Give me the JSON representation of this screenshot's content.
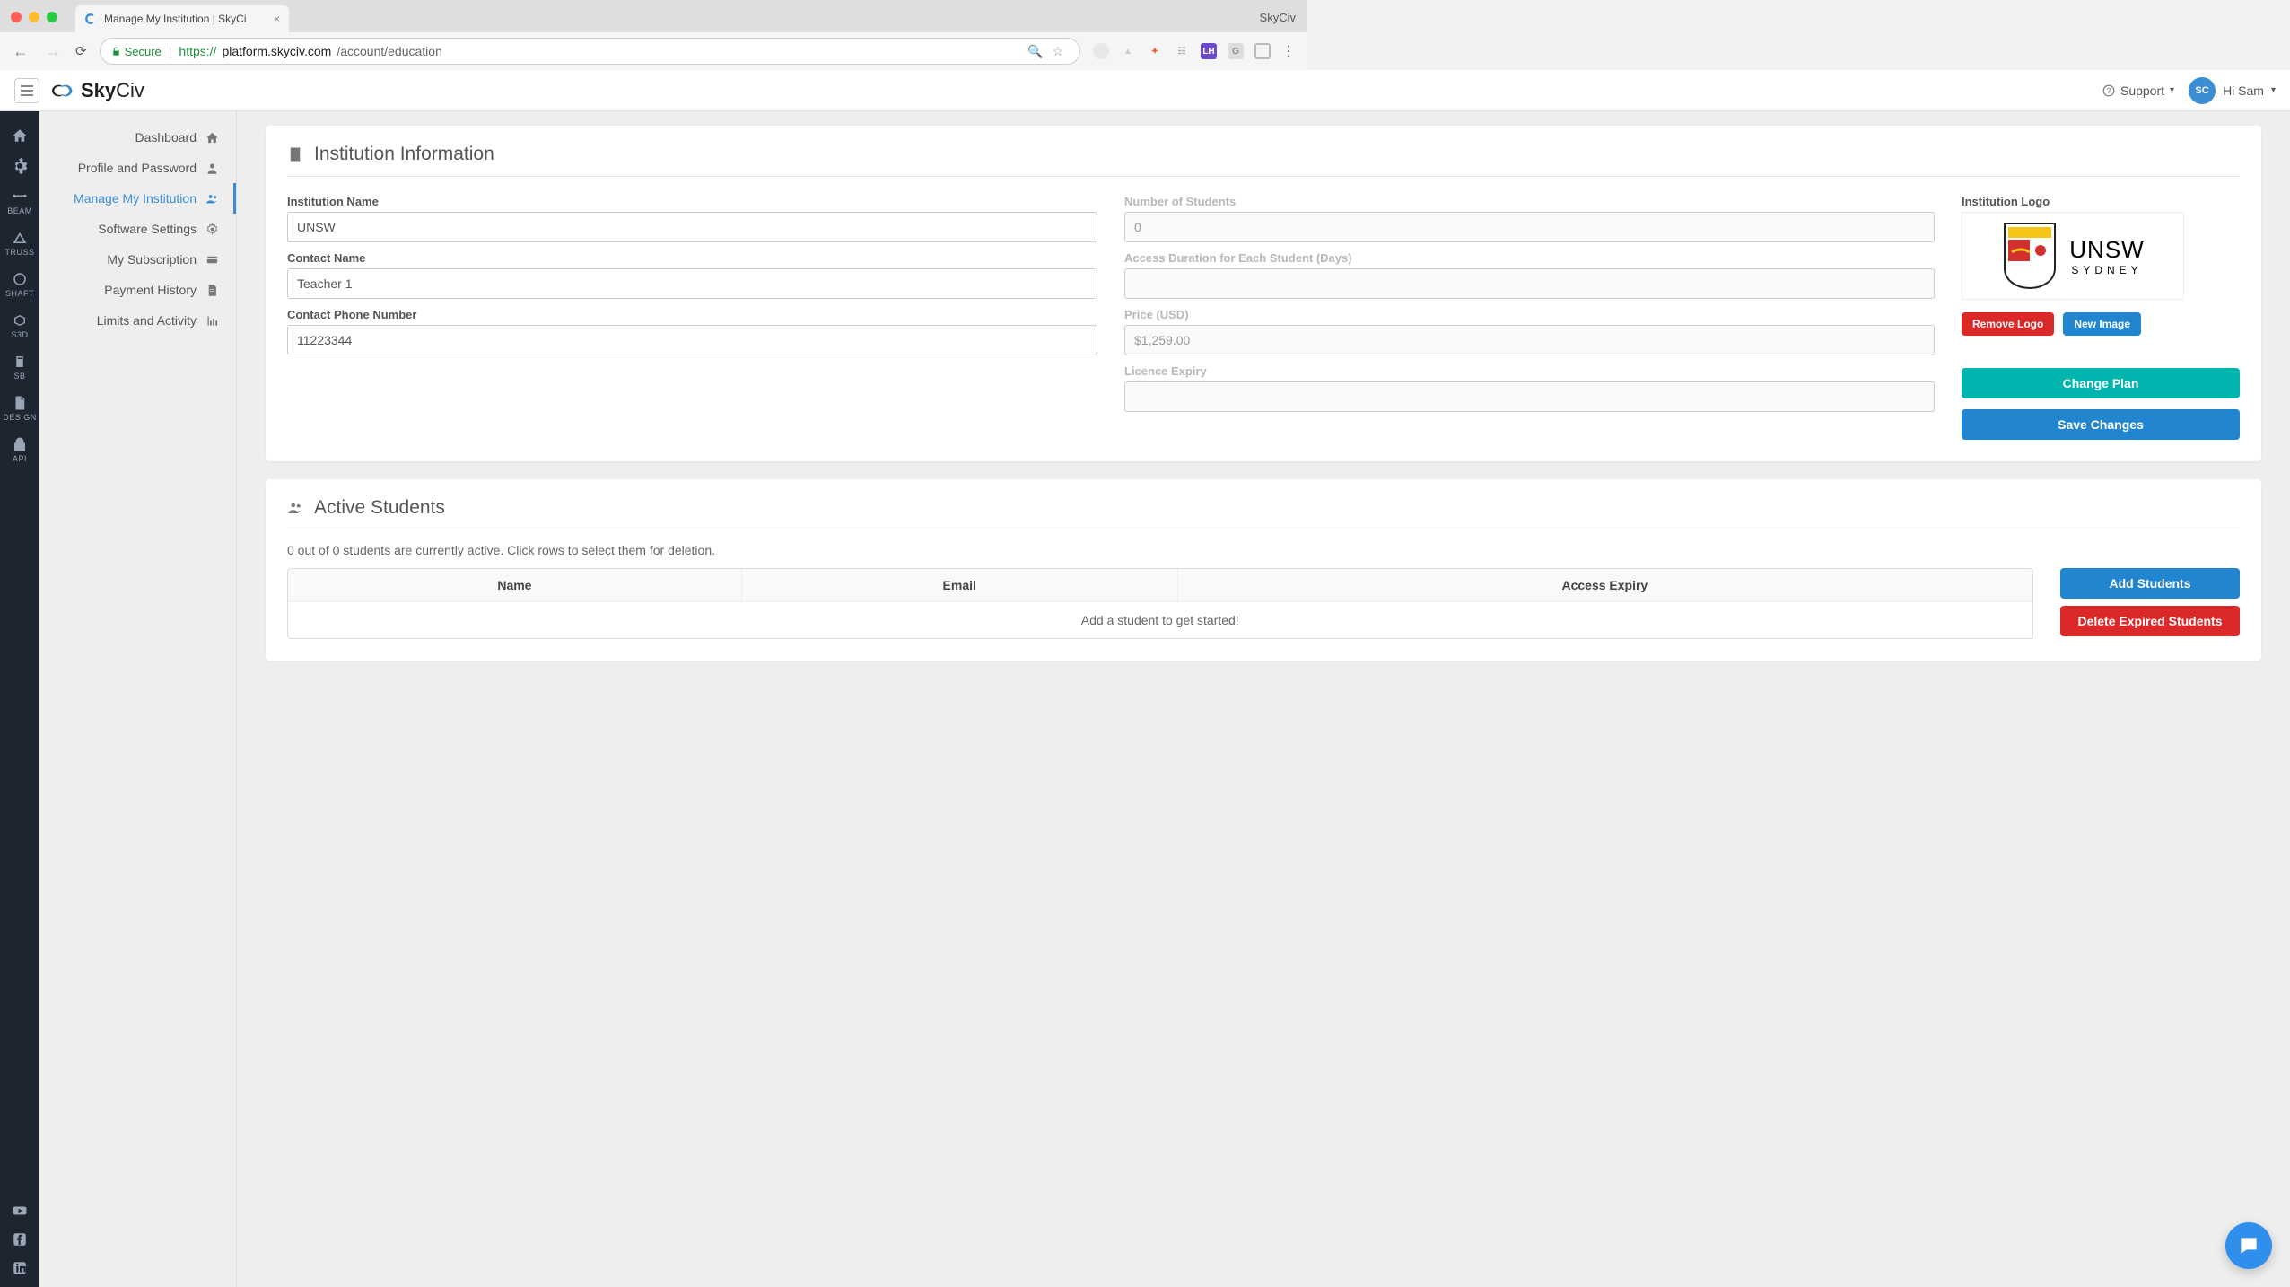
{
  "browser": {
    "tab_title": "Manage My Institution | SkyCi",
    "window_title": "SkyCiv",
    "secure_label": "Secure",
    "url_prefix": "https://",
    "url_host": "platform.skyciv.com",
    "url_path": "/account/education"
  },
  "topbar": {
    "brand_a": "Sky",
    "brand_b": "Civ",
    "support_label": "Support",
    "avatar": "SC",
    "greeting": "Hi Sam"
  },
  "sidebar_dark": {
    "items": [
      {
        "label": ""
      },
      {
        "label": ""
      },
      {
        "label": "BEAM"
      },
      {
        "label": "TRUSS"
      },
      {
        "label": "SHAFT"
      },
      {
        "label": "S3D"
      },
      {
        "label": "SB"
      },
      {
        "label": "DESIGN"
      },
      {
        "label": "API"
      }
    ]
  },
  "settings_nav": {
    "items": [
      {
        "label": "Dashboard"
      },
      {
        "label": "Profile and Password"
      },
      {
        "label": "Manage My Institution"
      },
      {
        "label": "Software Settings"
      },
      {
        "label": "My Subscription"
      },
      {
        "label": "Payment History"
      },
      {
        "label": "Limits and Activity"
      }
    ]
  },
  "institution": {
    "title": "Institution Information",
    "labels": {
      "name": "Institution Name",
      "contact": "Contact Name",
      "phone": "Contact Phone Number",
      "students": "Number of Students",
      "duration": "Access Duration for Each Student (Days)",
      "price": "Price (USD)",
      "expiry": "Licence Expiry",
      "logo": "Institution Logo"
    },
    "values": {
      "name": "UNSW",
      "contact": "Teacher 1",
      "phone": "11223344",
      "students": "0",
      "duration": "",
      "price": "$1,259.00",
      "expiry": ""
    },
    "logo_text_a": "UNSW",
    "logo_text_b": "SYDNEY",
    "buttons": {
      "remove_logo": "Remove Logo",
      "new_image": "New Image",
      "change_plan": "Change Plan",
      "save": "Save Changes"
    }
  },
  "students": {
    "title": "Active Students",
    "status": "0 out of 0 students are currently active. Click rows to select them for deletion.",
    "headers": {
      "name": "Name",
      "email": "Email",
      "expiry": "Access Expiry"
    },
    "empty": "Add a student to get started!",
    "buttons": {
      "add": "Add Students",
      "delete": "Delete Expired Students"
    }
  }
}
